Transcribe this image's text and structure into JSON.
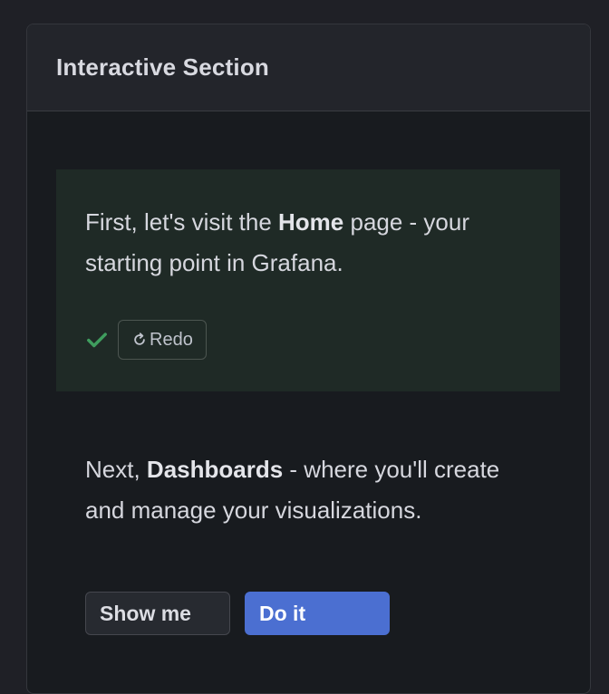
{
  "section": {
    "title": "Interactive Section"
  },
  "steps": [
    {
      "text_before": "First, let's visit the ",
      "highlight": "Home",
      "text_after": " page - your starting point in Grafana.",
      "status_icon": "check-icon",
      "redo_label": "Redo",
      "redo_icon": "redo-icon"
    },
    {
      "text_before": "Next, ",
      "highlight": "Dashboards",
      "text_after": " - where you'll create and manage your visualizations.",
      "show_me_label": "Show me",
      "do_it_label": "Do it"
    }
  ],
  "colors": {
    "success": "#3f9d5e",
    "primary": "#4b6fd1",
    "completed_bg": "#1f2a26"
  }
}
